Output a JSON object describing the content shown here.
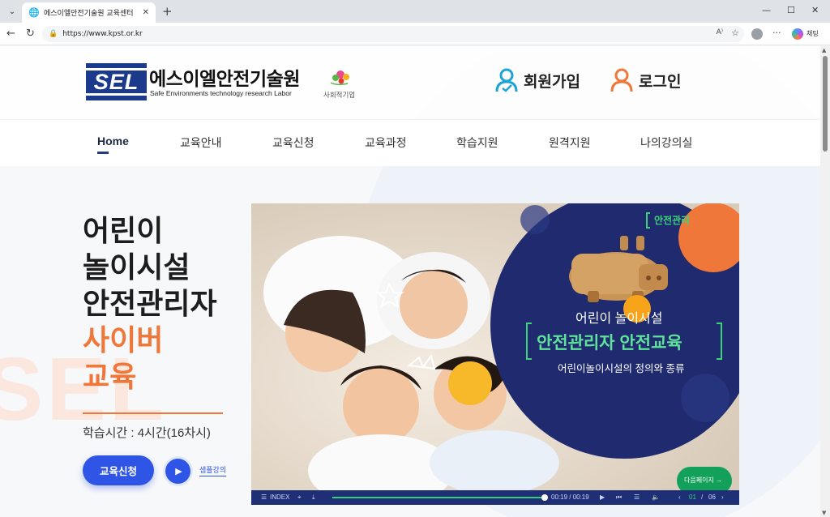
{
  "browser": {
    "tab_title": "에스이엘안전기술원 교육센터",
    "url": "https://www.kpst.or.kr",
    "copilot_label": "채팅"
  },
  "header": {
    "logo_mark": "SEL",
    "logo_name": "에스이엘안전기술원",
    "logo_sub": "Safe Environments technology research Labor",
    "social_label": "사회적기업",
    "signup_label": "회원가입",
    "login_label": "로그인"
  },
  "nav": {
    "items": [
      {
        "label": "Home"
      },
      {
        "label": "교육안내"
      },
      {
        "label": "교육신청"
      },
      {
        "label": "교육과정"
      },
      {
        "label": "학습지원"
      },
      {
        "label": "원격지원"
      },
      {
        "label": "나의강의실"
      }
    ]
  },
  "hero": {
    "watermark": "SEL",
    "title_lines": [
      "어린이",
      "놀이시설",
      "안전관리자"
    ],
    "highlight_lines": [
      "사이버",
      "교육"
    ],
    "study_time": "학습시간 : 4시간(16차시)",
    "apply_label": "교육신청",
    "sample_label": "샘플강의"
  },
  "video": {
    "tag": "안전관리",
    "line1": "어린이 놀이시설",
    "line2": "안전관리자 안전교육",
    "line3": "어린이놀이시설의 정의와 종류",
    "next_label": "다음페이지 →",
    "index_label": "INDEX",
    "time": "00:19 / 00:19",
    "progress": 1.0,
    "page_current": "01",
    "page_total": "06"
  },
  "colors": {
    "accent": "#f0773a",
    "primary": "#2f55e6",
    "navy": "#1f2f75",
    "signup_icon": "#1fa3d6",
    "login_icon": "#f0773a"
  }
}
